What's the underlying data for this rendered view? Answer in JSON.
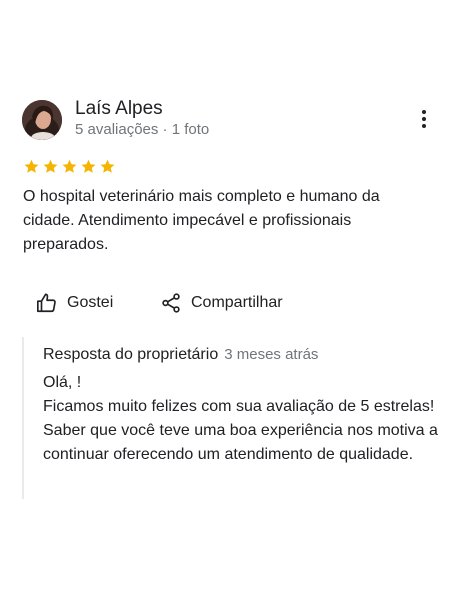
{
  "review": {
    "author_name": "Laís Alpes",
    "author_meta": "5 avaliações · 1 foto",
    "rating": 5,
    "star_color": "#f4b400",
    "text": "O hospital veterinário mais completo e humano da cidade. Atendimento impecável e profissionais preparados."
  },
  "actions": {
    "like_label": "Gostei",
    "share_label": "Compartilhar"
  },
  "owner_reply": {
    "title": "Resposta do proprietário",
    "time": "3 meses atrás",
    "text": "Olá, !\n Ficamos muito felizes com sua avaliação de 5 estrelas! Saber que você teve uma boa experiência nos motiva a continuar oferecendo um atendimento de qualidade."
  },
  "icons": {
    "more": "more-vert-icon",
    "like": "thumb-up-icon",
    "share": "share-icon",
    "star": "star-icon"
  }
}
